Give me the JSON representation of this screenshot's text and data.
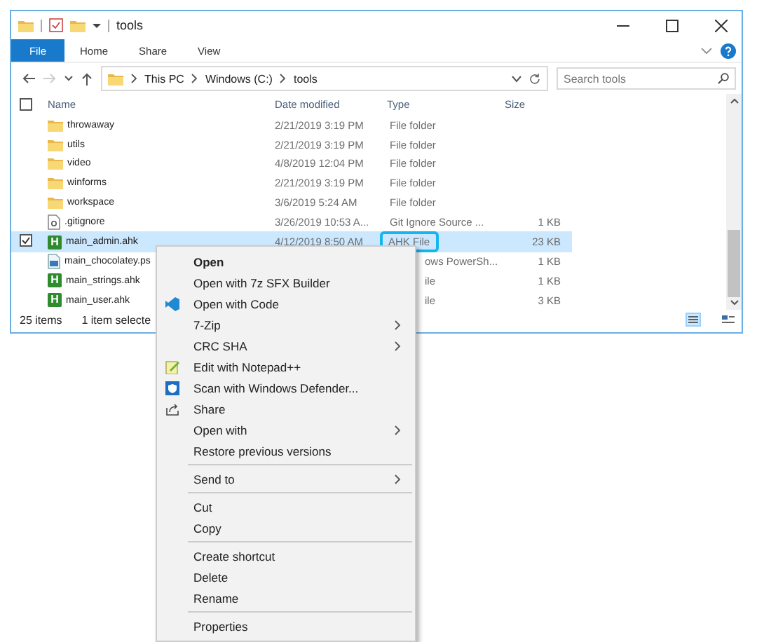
{
  "window": {
    "title": "tools"
  },
  "ribbon": {
    "tabs": [
      {
        "label": "File",
        "kind": "file-menu"
      },
      {
        "label": "Home",
        "kind": "tab"
      },
      {
        "label": "Share",
        "kind": "tab"
      },
      {
        "label": "View",
        "kind": "tab"
      }
    ]
  },
  "address": {
    "segments": [
      "This PC",
      "Windows (C:)",
      "tools"
    ]
  },
  "search": {
    "placeholder": "Search tools"
  },
  "table": {
    "select_all_checked": false,
    "columns": [
      "Name",
      "Date modified",
      "Type",
      "Size"
    ],
    "rows": [
      {
        "kind": "folder",
        "name": "throwaway",
        "date": "2/21/2019 3:19 PM",
        "type": "File folder",
        "selected": false,
        "checked": false
      },
      {
        "kind": "folder",
        "name": "utils",
        "date": "2/21/2019 3:19 PM",
        "type": "File folder",
        "selected": false,
        "checked": false
      },
      {
        "kind": "folder",
        "name": "video",
        "date": "4/8/2019 12:04 PM",
        "type": "File folder",
        "selected": false,
        "checked": false
      },
      {
        "kind": "folder",
        "name": "winforms",
        "date": "2/21/2019 3:19 PM",
        "type": "File folder",
        "selected": false,
        "checked": false
      },
      {
        "kind": "folder",
        "name": "workspace",
        "date": "3/6/2019 5:24 AM",
        "type": "File folder",
        "selected": false,
        "checked": false
      },
      {
        "kind": "file",
        "name": ".gitignore",
        "date": "3/26/2019 10:53 A...",
        "type": "Git Ignore Source ...",
        "size": "1 KB",
        "selected": false,
        "checked": false
      },
      {
        "kind": "script",
        "icon_glyph": "H",
        "name": "main_admin.ahk",
        "date": "4/12/2019 8:50 AM",
        "type": "AHK File",
        "type_highlighted": true,
        "size": "23 KB",
        "selected": true,
        "checked": true
      },
      {
        "kind": "ps-script",
        "name": "main_chocolatey.ps",
        "type": "ows PowerSh...",
        "size": "1 KB",
        "selected": false,
        "checked": false
      },
      {
        "kind": "script",
        "icon_glyph": "H",
        "name": "main_strings.ahk",
        "type": "ile",
        "size": "1 KB",
        "selected": false,
        "checked": false
      },
      {
        "kind": "script",
        "icon_glyph": "H",
        "name": "main_user.ahk",
        "type": "ile",
        "size": "3 KB",
        "selected": false,
        "checked": false
      }
    ]
  },
  "status_bar": {
    "count": "25 items",
    "selection": "1 item selecte"
  },
  "context_menu": {
    "items": [
      {
        "kind": "item",
        "label": "Open",
        "bold": true,
        "submenu": false
      },
      {
        "kind": "item",
        "label": "Open with 7z SFX Builder",
        "bold": false,
        "submenu": false
      },
      {
        "kind": "code-item",
        "label": "Open with Code",
        "bold": false,
        "submenu": false
      },
      {
        "kind": "item",
        "label": "7-Zip",
        "bold": false,
        "submenu": true
      },
      {
        "kind": "item",
        "label": "CRC SHA",
        "bold": false,
        "submenu": true
      },
      {
        "kind": "notepad-item",
        "label": "Edit with Notepad++",
        "bold": false,
        "submenu": false
      },
      {
        "kind": "defender-item",
        "label": "Scan with Windows Defender...",
        "bold": false,
        "submenu": false
      },
      {
        "kind": "share-item",
        "label": "Share",
        "bold": false,
        "submenu": false
      },
      {
        "kind": "item",
        "label": "Open with",
        "bold": false,
        "submenu": true
      },
      {
        "kind": "item",
        "label": "Restore previous versions",
        "bold": false,
        "submenu": false
      },
      {
        "kind": "separator"
      },
      {
        "kind": "item",
        "label": "Send to",
        "bold": false,
        "submenu": true
      },
      {
        "kind": "separator"
      },
      {
        "kind": "item",
        "label": "Cut",
        "bold": false,
        "submenu": false
      },
      {
        "kind": "item",
        "label": "Copy",
        "bold": false,
        "submenu": false
      },
      {
        "kind": "separator"
      },
      {
        "kind": "item",
        "label": "Create shortcut",
        "bold": false,
        "submenu": false
      },
      {
        "kind": "item",
        "label": "Delete",
        "bold": false,
        "submenu": false
      },
      {
        "kind": "item",
        "label": "Rename",
        "bold": false,
        "submenu": false
      },
      {
        "kind": "separator"
      },
      {
        "kind": "item",
        "label": "Properties",
        "bold": false,
        "submenu": false
      }
    ]
  }
}
